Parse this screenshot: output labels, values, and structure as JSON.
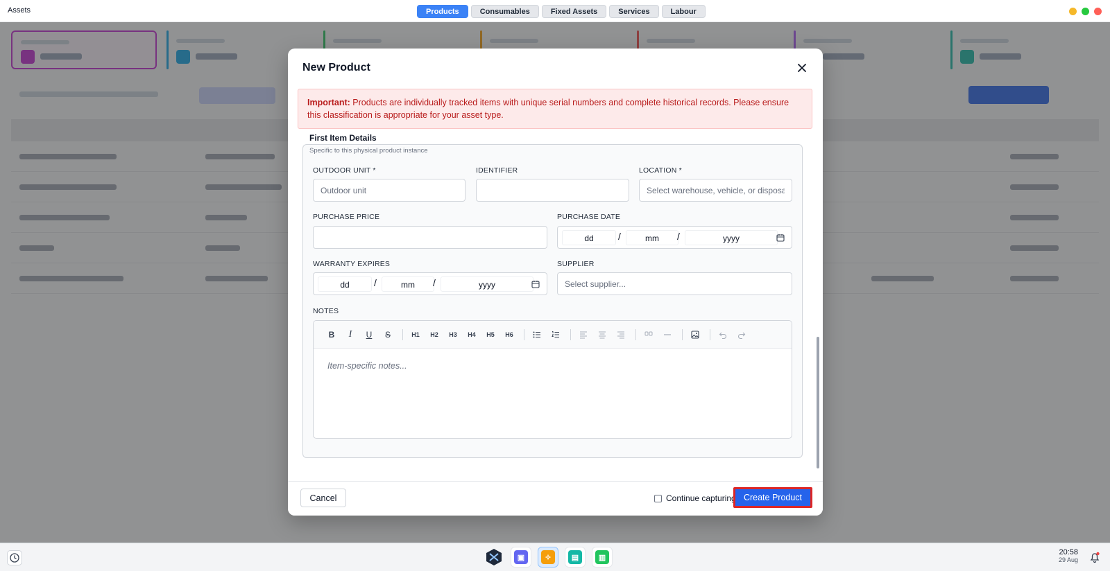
{
  "app": {
    "title": "Assets"
  },
  "tabs": [
    {
      "label": "Products",
      "active": true
    },
    {
      "label": "Consumables",
      "active": false
    },
    {
      "label": "Fixed Assets",
      "active": false
    },
    {
      "label": "Services",
      "active": false
    },
    {
      "label": "Labour",
      "active": false
    }
  ],
  "window_controls": {
    "minimize_color": "#f5b829",
    "maximize_color": "#27c93f",
    "close_color": "#ff5f57"
  },
  "modal": {
    "title": "New Product",
    "alert": {
      "strong": "Important:",
      "text": "Products are individually tracked items with unique serial numbers and complete historical records. Please ensure this classification is appropriate for your asset type."
    },
    "section": {
      "title": "First Item Details",
      "subtitle": "Specific to this physical product instance"
    },
    "fields": {
      "outdoor_unit": {
        "label": "OUTDOOR UNIT *",
        "placeholder": "Outdoor unit",
        "value": ""
      },
      "identifier": {
        "label": "IDENTIFIER",
        "placeholder": "",
        "value": ""
      },
      "location": {
        "label": "LOCATION *",
        "placeholder": "Select warehouse, vehicle, or disposal",
        "value": ""
      },
      "purchase_price": {
        "label": "PURCHASE PRICE",
        "placeholder": "",
        "value": ""
      },
      "purchase_date": {
        "label": "PURCHASE DATE",
        "day": "dd",
        "month": "mm",
        "year": "yyyy"
      },
      "warranty_expires": {
        "label": "WARRANTY EXPIRES",
        "day": "dd",
        "month": "mm",
        "year": "yyyy"
      },
      "supplier": {
        "label": "SUPPLIER",
        "placeholder": "Select supplier...",
        "value": ""
      },
      "notes": {
        "label": "NOTES",
        "placeholder": "Item-specific notes..."
      }
    },
    "toolbar": {
      "bold": "B",
      "italic": "I",
      "underline": "U",
      "strike": "S",
      "h1": "H1",
      "h2": "H2",
      "h3": "H3",
      "h4": "H4",
      "h5": "H5",
      "h6": "H6"
    },
    "footer": {
      "cancel_label": "Cancel",
      "continue_label": "Continue capturing",
      "continue_checked": false,
      "create_label": "Create Product"
    }
  },
  "taskbar": {
    "time": "20:58",
    "date": "29 Aug",
    "apps": [
      {
        "icon": "app-logo-icon",
        "color": "#1e293b"
      },
      {
        "icon": "contacts-app-icon",
        "color": "#6366f1"
      },
      {
        "icon": "assets-app-icon",
        "color": "#f59e0b"
      },
      {
        "icon": "sheets-app-icon",
        "color": "#14b8a6"
      },
      {
        "icon": "clipboard-app-icon",
        "color": "#22c55e"
      }
    ]
  }
}
